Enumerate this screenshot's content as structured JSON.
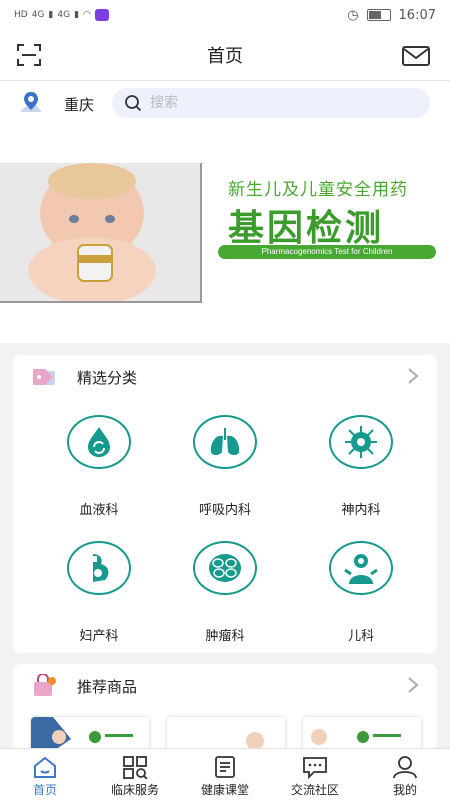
{
  "status_bar": {
    "network_left": "HD",
    "signal_1": "4G",
    "signal_2": "4G",
    "time": "16:07"
  },
  "nav": {
    "title": "首页",
    "scan_icon": "scan-icon",
    "mail_icon": "mail-icon"
  },
  "location": {
    "city": "重庆",
    "icon": "location-pin-icon"
  },
  "search": {
    "placeholder": "搜索"
  },
  "banner": {
    "subtitle": "新生儿及儿童安全用药",
    "title": "基因检测",
    "caption": "Pharmacogenomics Test for Children",
    "accent": "#47a833"
  },
  "categories_section": {
    "title": "精选分类",
    "items": [
      {
        "label": "血液科",
        "icon": "blood-drop-icon"
      },
      {
        "label": "呼吸内科",
        "icon": "lungs-icon"
      },
      {
        "label": "神内科",
        "icon": "neuron-icon"
      },
      {
        "label": "妇产科",
        "icon": "pregnancy-icon"
      },
      {
        "label": "肿瘤科",
        "icon": "tumor-cells-icon"
      },
      {
        "label": "儿科",
        "icon": "child-icon"
      }
    ],
    "accent": "#179a8e"
  },
  "recommend_section": {
    "title": "推荐商品"
  },
  "tab_bar": {
    "tabs": [
      {
        "label": "首页",
        "icon": "home-icon",
        "active": true
      },
      {
        "label": "临床服务",
        "icon": "grid-search-icon",
        "active": false
      },
      {
        "label": "健康课堂",
        "icon": "document-icon",
        "active": false
      },
      {
        "label": "交流社区",
        "icon": "chat-bubble-icon",
        "active": false
      },
      {
        "label": "我的",
        "icon": "user-icon",
        "active": false
      }
    ],
    "active_color": "#3f78c8"
  }
}
